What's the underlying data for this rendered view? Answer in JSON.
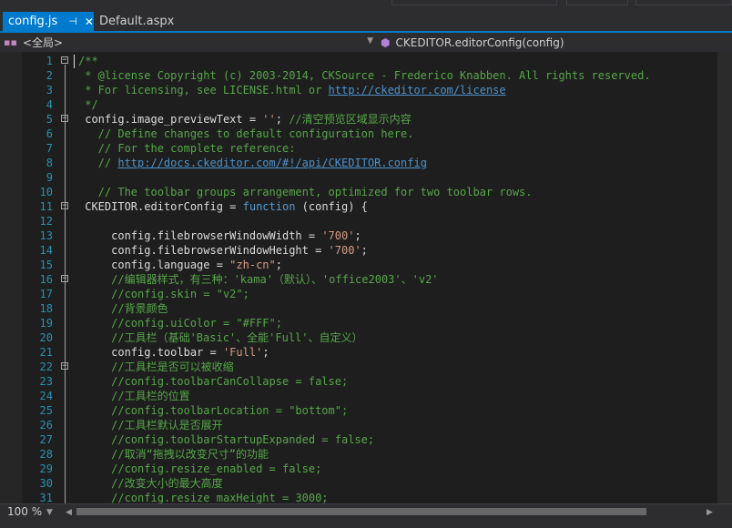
{
  "tabs": [
    {
      "label": "config.js",
      "active": true,
      "pin_glyph": "⊣",
      "close_glyph": "✕"
    },
    {
      "label": "Default.aspx",
      "active": false
    }
  ],
  "navbar": {
    "scope": "<全局>",
    "member": "CKEDITOR.editorConfig(config)"
  },
  "editor": {
    "lines": [
      {
        "n": "1",
        "fold": "−",
        "indent": 0,
        "tokens": [
          [
            "cm",
            "/**"
          ]
        ]
      },
      {
        "n": "2",
        "indent": 0,
        "tokens": [
          [
            "cm",
            " * @license Copyright (c) 2003-2014, CKSource - Frederico Knabben. All rights reserved."
          ]
        ]
      },
      {
        "n": "3",
        "indent": 0,
        "tokens": [
          [
            "cm",
            " * For licensing, see LICENSE.html or "
          ],
          [
            "ln",
            "http://ckeditor.com/license"
          ]
        ]
      },
      {
        "n": "4",
        "indent": 0,
        "tokens": [
          [
            "cm",
            " */"
          ]
        ]
      },
      {
        "n": "5",
        "fold": "−",
        "indent": 0,
        "tokens": [
          [
            "id",
            " config.image_previewText = "
          ],
          [
            "st",
            "''"
          ],
          [
            "id",
            "; "
          ],
          [
            "cm",
            "//清空预览区域显示内容"
          ]
        ]
      },
      {
        "n": "6",
        "indent": 0,
        "tokens": [
          [
            "cm",
            "   // Define changes to default configuration here."
          ]
        ]
      },
      {
        "n": "7",
        "indent": 0,
        "tokens": [
          [
            "cm",
            "   // For the complete reference:"
          ]
        ]
      },
      {
        "n": "8",
        "indent": 0,
        "tokens": [
          [
            "cm",
            "   // "
          ],
          [
            "ln",
            "http://docs.ckeditor.com/#!/api/CKEDITOR.config"
          ]
        ]
      },
      {
        "n": "9",
        "indent": 0,
        "tokens": [
          [
            "id",
            ""
          ]
        ]
      },
      {
        "n": "10",
        "indent": 0,
        "tokens": [
          [
            "cm",
            "   // The toolbar groups arrangement, optimized for two toolbar rows."
          ]
        ]
      },
      {
        "n": "11",
        "fold": "−",
        "indent": 0,
        "tokens": [
          [
            "id",
            " CKEDITOR.editorConfig = "
          ],
          [
            "kw",
            "function"
          ],
          [
            "id",
            " (config) {"
          ]
        ]
      },
      {
        "n": "12",
        "indent": 0,
        "tokens": [
          [
            "id",
            ""
          ]
        ]
      },
      {
        "n": "13",
        "indent": 0,
        "tokens": [
          [
            "id",
            "     config.filebrowserWindowWidth = "
          ],
          [
            "st",
            "'700'"
          ],
          [
            "id",
            ";"
          ]
        ]
      },
      {
        "n": "14",
        "indent": 0,
        "tokens": [
          [
            "id",
            "     config.filebrowserWindowHeight = "
          ],
          [
            "st",
            "'700'"
          ],
          [
            "id",
            ";"
          ]
        ]
      },
      {
        "n": "15",
        "indent": 0,
        "tokens": [
          [
            "id",
            "     config.language = "
          ],
          [
            "st",
            "\"zh-cn\""
          ],
          [
            "id",
            ";"
          ]
        ]
      },
      {
        "n": "16",
        "fold": "−",
        "indent": 0,
        "tokens": [
          [
            "cm",
            "     //编辑器样式，有三种：'kama'（默认）、'office2003'、'v2'"
          ]
        ]
      },
      {
        "n": "17",
        "indent": 0,
        "tokens": [
          [
            "cm",
            "     //config.skin = \"v2\";"
          ]
        ]
      },
      {
        "n": "18",
        "indent": 0,
        "tokens": [
          [
            "cm",
            "     //背景颜色"
          ]
        ]
      },
      {
        "n": "19",
        "indent": 0,
        "tokens": [
          [
            "cm",
            "     //config.uiColor = \"#FFF\";"
          ]
        ]
      },
      {
        "n": "20",
        "indent": 0,
        "tokens": [
          [
            "cm",
            "     //工具栏（基础'Basic'、全能'Full'、自定义）"
          ]
        ]
      },
      {
        "n": "21",
        "indent": 0,
        "tokens": [
          [
            "id",
            "     config.toolbar = "
          ],
          [
            "st",
            "'Full'"
          ],
          [
            "id",
            ";"
          ]
        ]
      },
      {
        "n": "22",
        "fold": "−",
        "indent": 0,
        "tokens": [
          [
            "cm",
            "     //工具栏是否可以被收缩"
          ]
        ]
      },
      {
        "n": "23",
        "indent": 0,
        "tokens": [
          [
            "cm",
            "     //config.toolbarCanCollapse = false;"
          ]
        ]
      },
      {
        "n": "24",
        "indent": 0,
        "tokens": [
          [
            "cm",
            "     //工具栏的位置"
          ]
        ]
      },
      {
        "n": "25",
        "indent": 0,
        "tokens": [
          [
            "cm",
            "     //config.toolbarLocation = \"bottom\";"
          ]
        ]
      },
      {
        "n": "26",
        "indent": 0,
        "tokens": [
          [
            "cm",
            "     //工具栏默认是否展开"
          ]
        ]
      },
      {
        "n": "27",
        "indent": 0,
        "tokens": [
          [
            "cm",
            "     //config.toolbarStartupExpanded = false;"
          ]
        ]
      },
      {
        "n": "28",
        "indent": 0,
        "tokens": [
          [
            "cm",
            "     //取消“拖拽以改变尺寸”的功能"
          ]
        ]
      },
      {
        "n": "29",
        "indent": 0,
        "tokens": [
          [
            "cm",
            "     //config.resize_enabled = false;"
          ]
        ]
      },
      {
        "n": "30",
        "indent": 0,
        "tokens": [
          [
            "cm",
            "     //改变大小的最大高度"
          ]
        ]
      },
      {
        "n": "31",
        "indent": 0,
        "tokens": [
          [
            "cm",
            "     //config.resize_maxHeight = 3000;"
          ]
        ]
      }
    ]
  },
  "statusbar": {
    "zoom": "100 %"
  },
  "colors": {
    "accent": "#007acc",
    "comment": "#57a64a",
    "string": "#d69d85",
    "keyword": "#569cd6",
    "line_number": "#2b91af"
  }
}
